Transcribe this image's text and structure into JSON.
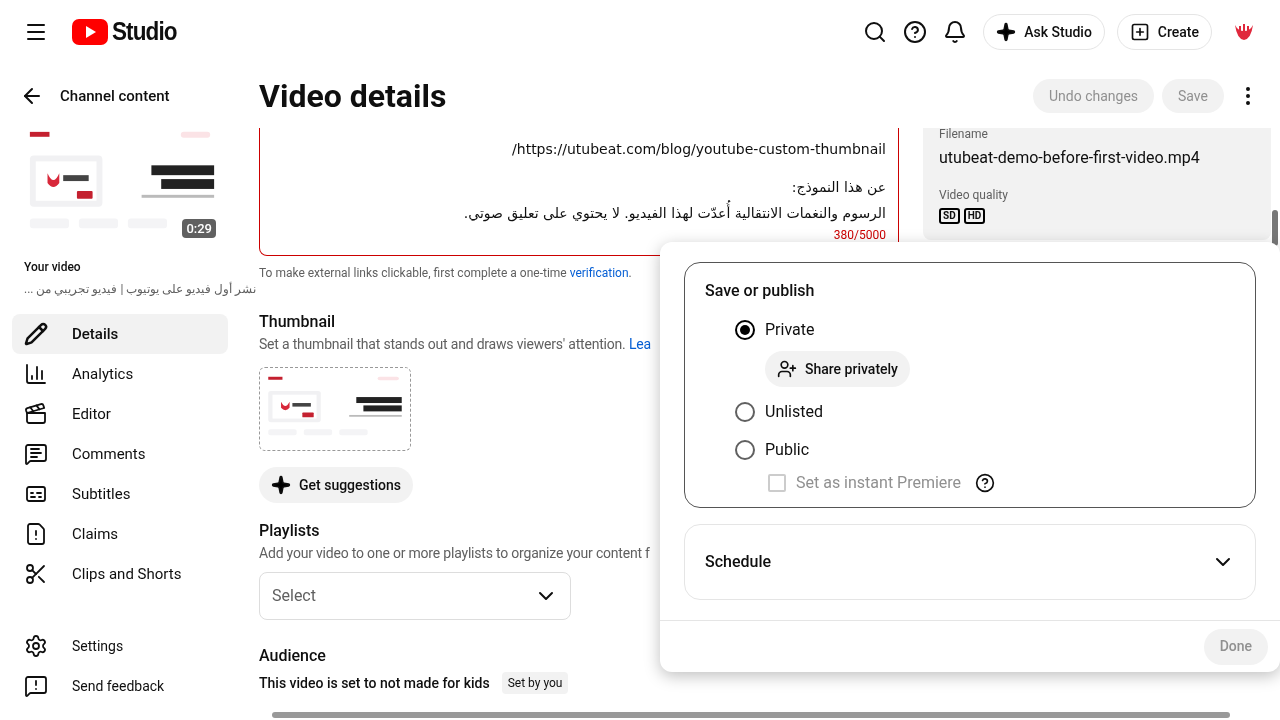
{
  "header": {
    "logo_text": "Studio",
    "ask_button": "Ask Studio",
    "create_button": "Create"
  },
  "sidebar": {
    "back_label": "Channel content",
    "duration": "0:29",
    "video_label": "Your video",
    "video_title": "نشر أول فيديو على يوتيوب | فيديو تجريبي من ...",
    "nav": [
      {
        "label": "Details",
        "selected": true
      },
      {
        "label": "Analytics",
        "selected": false
      },
      {
        "label": "Editor",
        "selected": false
      },
      {
        "label": "Comments",
        "selected": false
      },
      {
        "label": "Subtitles",
        "selected": false
      },
      {
        "label": "Claims",
        "selected": false
      },
      {
        "label": "Clips and Shorts",
        "selected": false
      }
    ],
    "footer": [
      {
        "label": "Settings"
      },
      {
        "label": "Send feedback"
      }
    ]
  },
  "page": {
    "title": "Video details",
    "undo_button": {
      "label": "Undo changes",
      "disabled": true
    },
    "save_button": {
      "label": "Save",
      "disabled": true
    }
  },
  "description": {
    "paragraphs": [
      [
        "/https://utubeat.com/blog/youtube-custom-thumbnail"
      ],
      [
        "عن هذا النموذج:",
        "الرسوم والنغمات الانتقالية أُعدّت لهذا الفيديو. لا يحتوي على تعليق صوتي."
      ]
    ],
    "counter": "380/5000",
    "error": true,
    "hint": "To make external links clickable, first complete a one-time",
    "hint_link": "verification",
    "hint_end": "."
  },
  "thumbnail": {
    "title": "Thumbnail",
    "desc": "Set a thumbnail that stands out and draws viewers' attention.",
    "link": "Lea",
    "button": "Get suggestions"
  },
  "playlists": {
    "title": "Playlists",
    "desc": "Add your video to one or more playlists to organize your content f",
    "placeholder": "Select"
  },
  "audience": {
    "title": "Audience",
    "status": "This video is set to not made for kids",
    "chip": "Set by you"
  },
  "info": {
    "filename_label": "Filename",
    "filename": "utubeat-demo-before-first-video.mp4",
    "quality_label": "Video quality",
    "qualities": [
      "SD",
      "HD"
    ]
  },
  "publish": {
    "title": "Save or publish",
    "options": [
      {
        "label": "Private",
        "selected": true
      },
      {
        "label": "Unlisted",
        "selected": false
      },
      {
        "label": "Public",
        "selected": false
      }
    ],
    "share_button": "Share privately",
    "premiere": {
      "label": "Set as instant Premiere",
      "checked": false,
      "disabled": true
    },
    "schedule": {
      "label": "Schedule",
      "expanded": false
    },
    "done": {
      "label": "Done",
      "disabled": true
    }
  }
}
